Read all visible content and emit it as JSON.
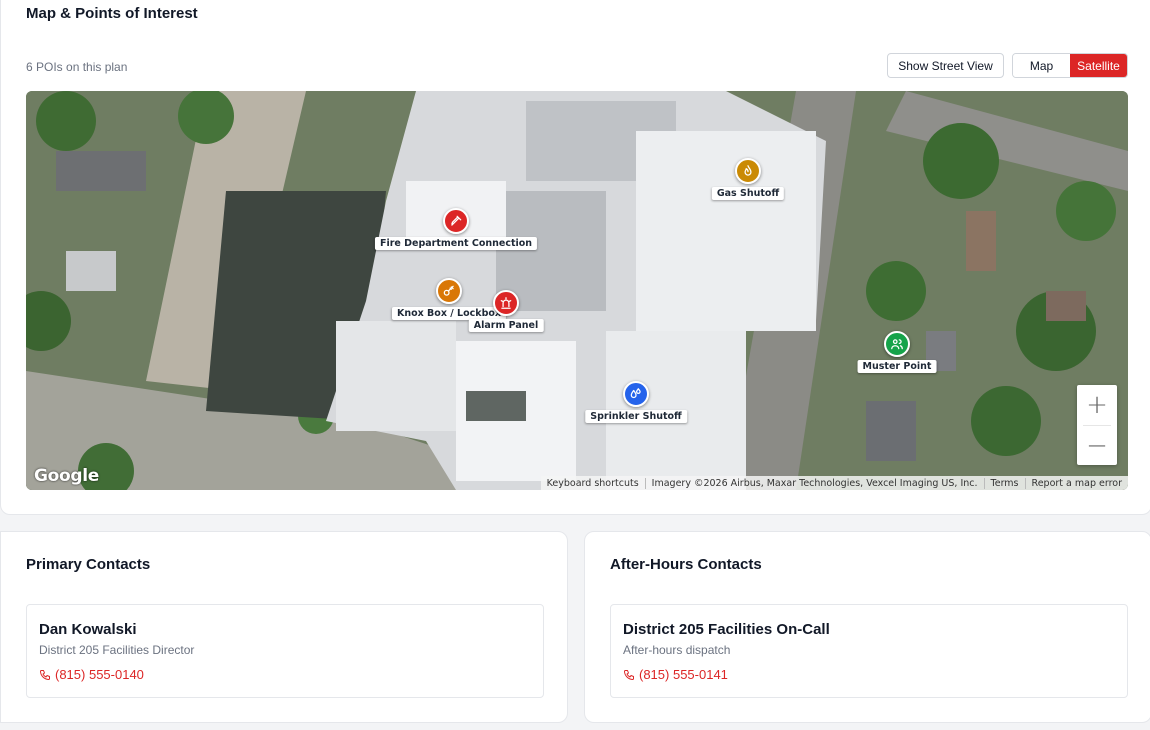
{
  "map_section": {
    "title": "Map & Points of Interest",
    "poi_count": "6 POIs on this plan",
    "street_view_label": "Show Street View",
    "map_type": {
      "options": [
        "Map",
        "Satellite"
      ],
      "selected": "Satellite"
    },
    "pois": [
      {
        "label": "Gas Shutoff",
        "icon": "flame-icon",
        "color": "#ca8a04"
      },
      {
        "label": "Fire Department Connection",
        "icon": "hydrant-icon",
        "color": "#dc2626"
      },
      {
        "label": "Knox Box / Lockbox",
        "icon": "key-icon",
        "color": "#d97706"
      },
      {
        "label": "Alarm Panel",
        "icon": "alarm-icon",
        "color": "#dc2626"
      },
      {
        "label": "Muster Point",
        "icon": "people-icon",
        "color": "#16a34a"
      },
      {
        "label": "Sprinkler Shutoff",
        "icon": "droplets-icon",
        "color": "#2563eb"
      }
    ],
    "zoom": {
      "in": "+",
      "out": "−"
    },
    "logo": "Google",
    "attribution": [
      "Keyboard shortcuts",
      "Imagery ©2026 Airbus, Maxar Technologies, Vexcel Imaging US, Inc.",
      "Terms",
      "Report a map error"
    ]
  },
  "primary_contacts": {
    "title": "Primary Contacts",
    "contact": {
      "name": "Dan Kowalski",
      "role": "District 205 Facilities Director",
      "phone": "(815) 555-0140"
    }
  },
  "after_hours_contacts": {
    "title": "After-Hours Contacts",
    "contact": {
      "name": "District 205 Facilities On-Call",
      "role": "After-hours dispatch",
      "phone": "(815) 555-0141"
    }
  },
  "accent_color": "#dc2626"
}
